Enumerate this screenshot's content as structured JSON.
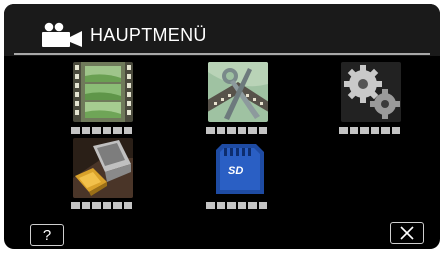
{
  "header": {
    "title": "HAUPTMENÜ",
    "mode_icon": "video-camera-icon"
  },
  "menu_items": [
    {
      "icon": "film-strip-icon",
      "label": "■■■■■■"
    },
    {
      "icon": "editing-tools-icon",
      "label": "■■■■■■"
    },
    {
      "icon": "gear-settings-icon",
      "label": "■■■■■■"
    },
    {
      "icon": "hdmi-connector-icon",
      "label": "■■■■■■"
    },
    {
      "icon": "sd-card-icon",
      "label": "■■■■■■"
    }
  ],
  "buttons": {
    "help_label": "?",
    "close_icon": "close-icon"
  },
  "colors": {
    "background": "#000000",
    "header": "#1a1a1a",
    "placeholder": "#c4c4c4",
    "sd_blue": "#1e4ba3"
  }
}
